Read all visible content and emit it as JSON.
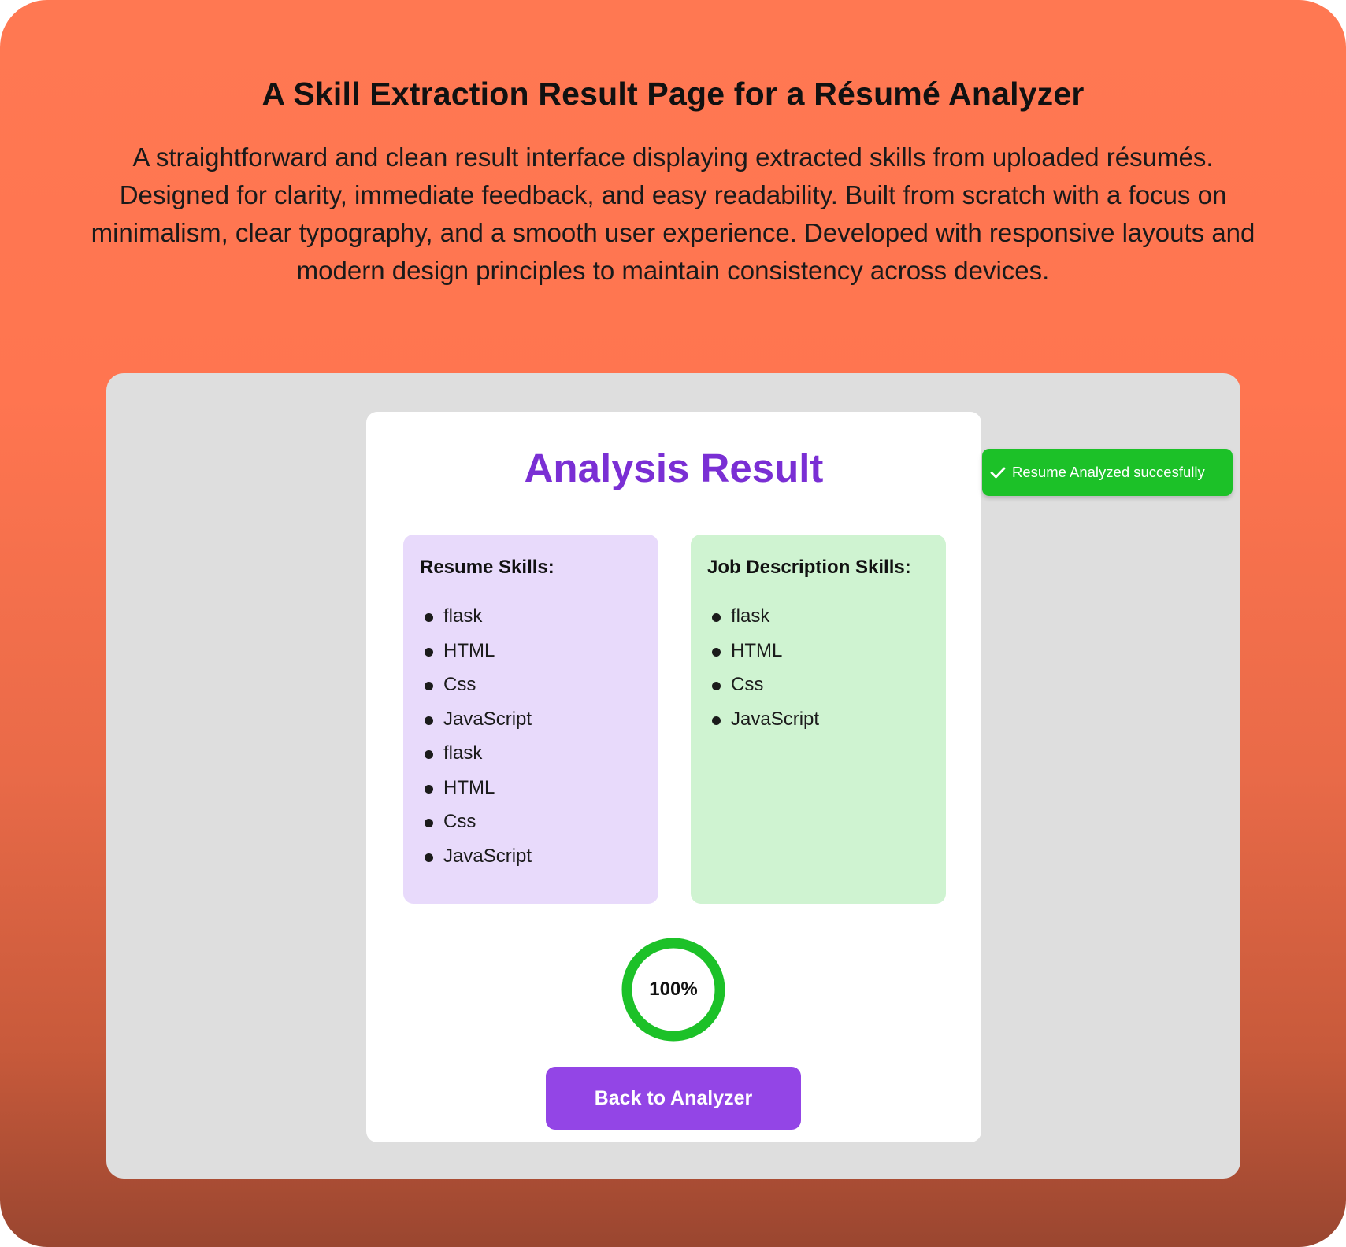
{
  "showcase": {
    "title": "A Skill Extraction Result Page for a Résumé Analyzer",
    "description": "A straightforward and clean result interface displaying extracted skills from uploaded résumés. Designed for clarity, immediate feedback, and easy readability. Built from scratch with a focus on minimalism, clear typography, and a smooth user experience. Developed with responsive layouts and modern design principles to maintain consistency across devices."
  },
  "result": {
    "title": "Analysis Result",
    "resume_panel": {
      "heading": "Resume Skills:",
      "skills": [
        "flask",
        "HTML",
        "Css",
        "JavaScript",
        "flask",
        "HTML",
        "Css",
        "JavaScript"
      ]
    },
    "job_panel": {
      "heading": "Job Description Skills:",
      "skills": [
        "flask",
        "HTML",
        "Css",
        "JavaScript"
      ]
    },
    "match": {
      "label": "100%",
      "fraction": 1.0
    },
    "back_button_label": "Back to Analyzer"
  },
  "toast": {
    "message": "Resume Analyzed succesfully",
    "icon": "check-icon"
  },
  "colors": {
    "accent_purple": "#9345e6",
    "title_purple": "#7a2fd4",
    "success_green": "#1cc128",
    "resume_panel_bg": "#e8dafb",
    "job_panel_bg": "#cff3d1",
    "frame_bg": "#dedede",
    "backdrop_top": "#ff7852",
    "backdrop_bottom": "#9a4630"
  }
}
